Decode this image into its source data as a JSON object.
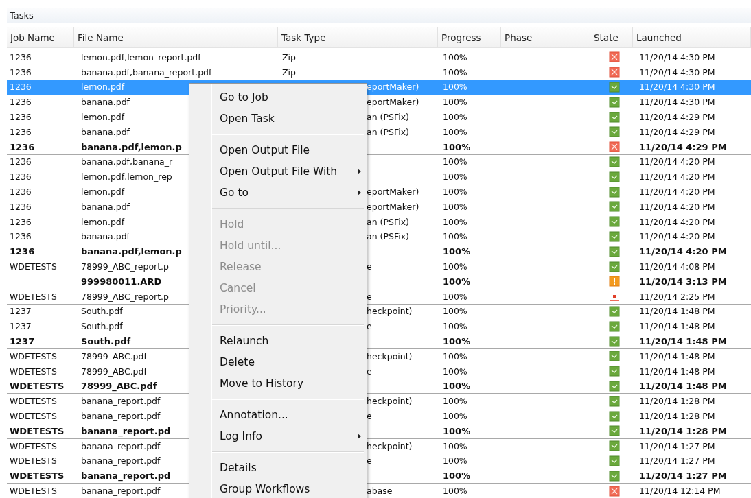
{
  "panel": {
    "title": "Tasks"
  },
  "table": {
    "columns": [
      "Job Name",
      "File Name",
      "Task Type",
      "Progress",
      "Phase",
      "State",
      "Launched"
    ],
    "rows": [
      {
        "job": "1236",
        "file": "lemon.pdf,lemon_report.pdf",
        "task": "Zip",
        "covered": false,
        "progress": "100%",
        "kind": "error",
        "launched": "11/20/14 4:30 PM",
        "bold": false,
        "selected": false,
        "divider_below": false
      },
      {
        "job": "1236",
        "file": "banana.pdf,banana_report.pdf",
        "task": "Zip",
        "covered": false,
        "progress": "100%",
        "kind": "error",
        "launched": "11/20/14 4:30 PM",
        "bold": false,
        "selected": false,
        "divider_below": false
      },
      {
        "job": "1236",
        "file": "lemon.pdf",
        "task": "eportMaker)",
        "covered": true,
        "progress": "100%",
        "kind": "ok",
        "launched": "11/20/14 4:30 PM",
        "bold": false,
        "selected": true,
        "divider_below": false
      },
      {
        "job": "1236",
        "file": "banana.pdf",
        "task": "eportMaker)",
        "covered": true,
        "progress": "100%",
        "kind": "ok",
        "launched": "11/20/14 4:30 PM",
        "bold": false,
        "selected": false,
        "divider_below": false
      },
      {
        "job": "1236",
        "file": "lemon.pdf",
        "task": "an (PSFix)",
        "covered": true,
        "progress": "100%",
        "kind": "ok",
        "launched": "11/20/14 4:29 PM",
        "bold": false,
        "selected": false,
        "divider_below": false
      },
      {
        "job": "1236",
        "file": "banana.pdf",
        "task": "an (PSFix)",
        "covered": true,
        "progress": "100%",
        "kind": "ok",
        "launched": "11/20/14 4:29 PM",
        "bold": false,
        "selected": false,
        "divider_below": false
      },
      {
        "job": "1236",
        "file": "banana.pdf,lemon.p",
        "progress": "100%",
        "kind": "error",
        "launched": "11/20/14 4:29 PM",
        "bold": true,
        "selected": false,
        "divider_below": true
      },
      {
        "job": "1236",
        "file": "banana.pdf,banana_r",
        "progress": "100%",
        "kind": "ok",
        "launched": "11/20/14 4:20 PM",
        "bold": false,
        "selected": false,
        "divider_below": false
      },
      {
        "job": "1236",
        "file": "lemon.pdf,lemon_rep",
        "progress": "100%",
        "kind": "ok",
        "launched": "11/20/14 4:20 PM",
        "bold": false,
        "selected": false,
        "divider_below": false
      },
      {
        "job": "1236",
        "file": "lemon.pdf",
        "task": "eportMaker)",
        "covered": true,
        "progress": "100%",
        "kind": "ok",
        "launched": "11/20/14 4:20 PM",
        "bold": false,
        "selected": false,
        "divider_below": false
      },
      {
        "job": "1236",
        "file": "banana.pdf",
        "task": "eportMaker)",
        "covered": true,
        "progress": "100%",
        "kind": "ok",
        "launched": "11/20/14 4:20 PM",
        "bold": false,
        "selected": false,
        "divider_below": false
      },
      {
        "job": "1236",
        "file": "lemon.pdf",
        "task": "an (PSFix)",
        "covered": true,
        "progress": "100%",
        "kind": "ok",
        "launched": "11/20/14 4:20 PM",
        "bold": false,
        "selected": false,
        "divider_below": false
      },
      {
        "job": "1236",
        "file": "banana.pdf",
        "task": "an (PSFix)",
        "covered": true,
        "progress": "100%",
        "kind": "ok",
        "launched": "11/20/14 4:20 PM",
        "bold": false,
        "selected": false,
        "divider_below": false
      },
      {
        "job": "1236",
        "file": "banana.pdf,lemon.p",
        "progress": "100%",
        "kind": "ok",
        "launched": "11/20/14 4:20 PM",
        "bold": true,
        "selected": false,
        "divider_below": true
      },
      {
        "job": "WDETESTS",
        "file": "78999_ABC_report.p",
        "task": "e",
        "covered": true,
        "progress": "100%",
        "kind": "ok",
        "launched": "11/20/14 4:08 PM",
        "bold": false,
        "selected": false,
        "divider_below": true
      },
      {
        "file": "999980011.ARD",
        "progress": "100%",
        "kind": "warning",
        "launched": "11/20/14 3:13 PM",
        "bold": true,
        "selected": false,
        "divider_below": true
      },
      {
        "job": "WDETESTS",
        "file": "78999_ABC_report.p",
        "task": "e",
        "covered": true,
        "progress": "100%",
        "kind": "stopped",
        "launched": "11/20/14 2:25 PM",
        "bold": false,
        "selected": false,
        "divider_below": true
      },
      {
        "job": "1237",
        "file": "South.pdf",
        "task": "heckpoint)",
        "covered": true,
        "progress": "100%",
        "kind": "ok",
        "launched": "11/20/14 1:48 PM",
        "bold": false,
        "selected": false,
        "divider_below": false
      },
      {
        "job": "1237",
        "file": "South.pdf",
        "task": "e",
        "covered": true,
        "progress": "100%",
        "kind": "ok",
        "launched": "11/20/14 1:48 PM",
        "bold": false,
        "selected": false,
        "divider_below": false
      },
      {
        "job": "1237",
        "file": "South.pdf",
        "progress": "100%",
        "kind": "ok",
        "launched": "11/20/14 1:48 PM",
        "bold": true,
        "selected": false,
        "divider_below": true
      },
      {
        "job": "WDETESTS",
        "file": "78999_ABC.pdf",
        "task": "heckpoint)",
        "covered": true,
        "progress": "100%",
        "kind": "ok",
        "launched": "11/20/14 1:48 PM",
        "bold": false,
        "selected": false,
        "divider_below": false
      },
      {
        "job": "WDETESTS",
        "file": "78999_ABC.pdf",
        "task": "e",
        "covered": true,
        "progress": "100%",
        "kind": "ok",
        "launched": "11/20/14 1:48 PM",
        "bold": false,
        "selected": false,
        "divider_below": false
      },
      {
        "job": "WDETESTS",
        "file": "78999_ABC.pdf",
        "progress": "100%",
        "kind": "ok",
        "launched": "11/20/14 1:48 PM",
        "bold": true,
        "selected": false,
        "divider_below": true
      },
      {
        "job": "WDETESTS",
        "file": "banana_report.pdf",
        "task": "heckpoint)",
        "covered": true,
        "progress": "100%",
        "kind": "ok",
        "launched": "11/20/14 1:28 PM",
        "bold": false,
        "selected": false,
        "divider_below": false
      },
      {
        "job": "WDETESTS",
        "file": "banana_report.pdf",
        "task": "e",
        "covered": true,
        "progress": "100%",
        "kind": "ok",
        "launched": "11/20/14 1:28 PM",
        "bold": false,
        "selected": false,
        "divider_below": false
      },
      {
        "job": "WDETESTS",
        "file": "banana_report.pd",
        "progress": "100%",
        "kind": "ok",
        "launched": "11/20/14 1:28 PM",
        "bold": true,
        "selected": false,
        "divider_below": true
      },
      {
        "job": "WDETESTS",
        "file": "banana_report.pdf",
        "task": "heckpoint)",
        "covered": true,
        "progress": "100%",
        "kind": "ok",
        "launched": "11/20/14 1:27 PM",
        "bold": false,
        "selected": false,
        "divider_below": false
      },
      {
        "job": "WDETESTS",
        "file": "banana_report.pdf",
        "task": "e",
        "covered": true,
        "progress": "100%",
        "kind": "ok",
        "launched": "11/20/14 1:27 PM",
        "bold": false,
        "selected": false,
        "divider_below": false
      },
      {
        "job": "WDETESTS",
        "file": "banana_report.pd",
        "progress": "100%",
        "kind": "ok",
        "launched": "11/20/14 1:27 PM",
        "bold": true,
        "selected": false,
        "divider_below": true
      },
      {
        "job": "WDETESTS",
        "file": "banana_report.pdf",
        "task": "abase",
        "covered": true,
        "progress": "100%",
        "kind": "error",
        "launched": "11/20/14 12:14 PM",
        "bold": false,
        "selected": false,
        "divider_below": false
      }
    ]
  },
  "context_menu": [
    {
      "kind": "item",
      "label": "Go to Job",
      "disabled": false,
      "submenu": false
    },
    {
      "kind": "item",
      "label": "Open Task",
      "disabled": false,
      "submenu": false
    },
    {
      "kind": "separator"
    },
    {
      "kind": "item",
      "label": "Open Output File",
      "disabled": false,
      "submenu": false
    },
    {
      "kind": "item",
      "label": "Open Output File With",
      "disabled": false,
      "submenu": true
    },
    {
      "kind": "item",
      "label": "Go to",
      "disabled": false,
      "submenu": true
    },
    {
      "kind": "separator"
    },
    {
      "kind": "item",
      "label": "Hold",
      "disabled": true,
      "submenu": false
    },
    {
      "kind": "item",
      "label": "Hold until...",
      "disabled": true,
      "submenu": false
    },
    {
      "kind": "item",
      "label": "Release",
      "disabled": true,
      "submenu": false
    },
    {
      "kind": "item",
      "label": "Cancel",
      "disabled": true,
      "submenu": false
    },
    {
      "kind": "item",
      "label": "Priority...",
      "disabled": true,
      "submenu": false
    },
    {
      "kind": "separator"
    },
    {
      "kind": "item",
      "label": "Relaunch",
      "disabled": false,
      "submenu": false
    },
    {
      "kind": "item",
      "label": "Delete",
      "disabled": false,
      "submenu": false
    },
    {
      "kind": "item",
      "label": "Move to History",
      "disabled": false,
      "submenu": false
    },
    {
      "kind": "separator"
    },
    {
      "kind": "item",
      "label": "Annotation...",
      "disabled": false,
      "submenu": false
    },
    {
      "kind": "item",
      "label": "Log Info",
      "disabled": false,
      "submenu": true
    },
    {
      "kind": "separator"
    },
    {
      "kind": "item",
      "label": "Details",
      "disabled": false,
      "submenu": false
    },
    {
      "kind": "item",
      "label": "Group Workflows",
      "disabled": false,
      "submenu": false
    }
  ]
}
